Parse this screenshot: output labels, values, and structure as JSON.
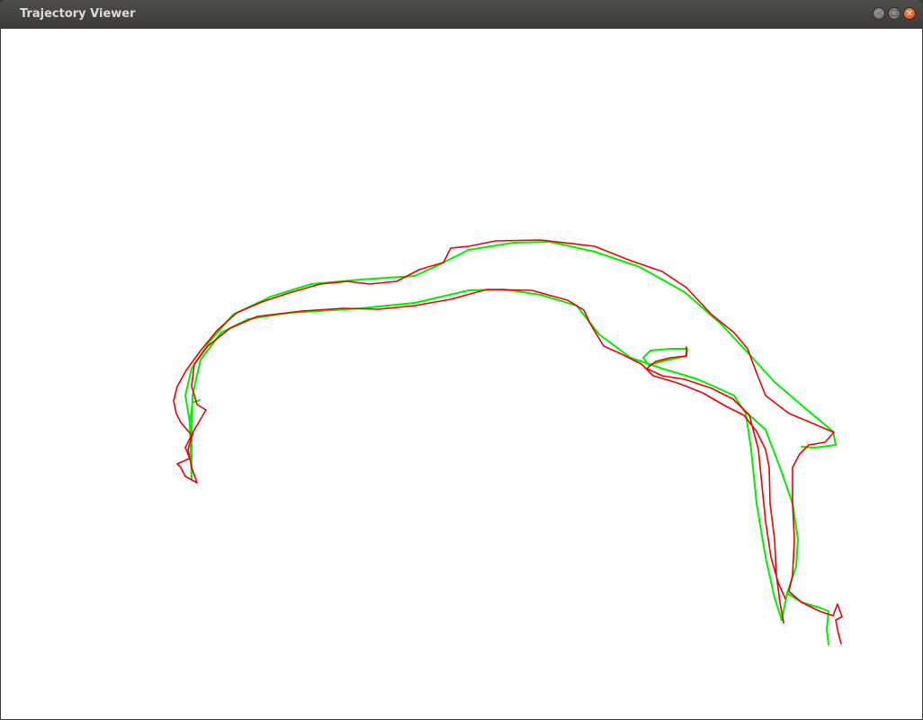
{
  "window": {
    "title": "Trajectory Viewer",
    "controls": [
      {
        "name": "minimize",
        "glyph": "–"
      },
      {
        "name": "maximize",
        "glyph": "□"
      },
      {
        "name": "close",
        "glyph": "×"
      }
    ]
  },
  "trajectories": {
    "ground_truth_color": "#00ee00",
    "estimated_color": "#ee0000"
  }
}
